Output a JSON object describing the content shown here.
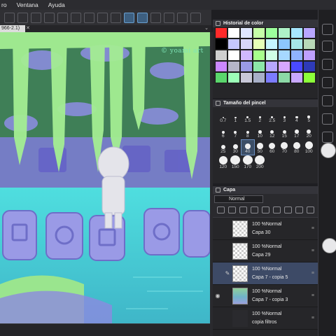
{
  "menu": {
    "items": [
      "ro",
      "Ventana",
      "Ayuda"
    ]
  },
  "document": {
    "tab_title": "966-2.1)",
    "close_glyph": "✕",
    "chevron_glyph": "⌄"
  },
  "canvas": {
    "watermark": "© yoami art",
    "colors": {
      "foliage": "#9be68f",
      "stone": "#8c8ae0",
      "water": "#52dfe0",
      "dark_green": "#2f6b45"
    }
  },
  "color_history": {
    "title": "Historial de color",
    "swatches": [
      "#ff2a2a",
      "#ffffff",
      "#dfe6ff",
      "#c6ffa8",
      "#9cff9c",
      "#aef2c8",
      "#a6e6ff",
      "#b8a6ff",
      "#000000",
      "#c5c8ff",
      "#d7d7f7",
      "#e6ffb8",
      "#c6f5ff",
      "#8cc6ff",
      "#a6e6e6",
      "#b8d8b8",
      "#cfcfcf",
      "#ffffff",
      "#d0b8ff",
      "#a8ff8c",
      "#d0ffe6",
      "#a6d8ff",
      "#8fb2ff",
      "#bfa0ff",
      "#cc88ff",
      "#b5b5c8",
      "#9a9ae6",
      "#8ce6a8",
      "#b8a6ff",
      "#d6a6ff",
      "#4a4aff",
      "#2e3ab8",
      "#5ad66c",
      "#9cffb8",
      "#c8c8d8",
      "#a8b0c8",
      "#7c7cff",
      "#8cd8a6",
      "#c8a8ff",
      "#8cff3a"
    ]
  },
  "brush_size": {
    "title": "Tamaño del pincel",
    "sizes": [
      "0.7",
      "1",
      "1.5",
      "2",
      "2.5",
      "3",
      "4",
      "5",
      "6",
      "7",
      "8",
      "10",
      "12",
      "15",
      "17",
      "20",
      "25",
      "30",
      "40",
      "50",
      "60",
      "70",
      "80",
      "100",
      "120",
      "150",
      "170",
      "200"
    ],
    "selected": "40"
  },
  "layers": {
    "title": "Capa",
    "blend_mode": "Normal",
    "items": [
      {
        "opacity": "100 %Normal",
        "name": "Capa 30",
        "type": "transparent",
        "selected": false,
        "visible": false,
        "editing": false
      },
      {
        "opacity": "100 %Normal",
        "name": "Capa 29",
        "type": "transparent",
        "selected": false,
        "visible": false,
        "editing": false
      },
      {
        "opacity": "100 %Normal",
        "name": "Capa 7 - copia 5",
        "type": "transparent",
        "selected": true,
        "visible": false,
        "editing": true
      },
      {
        "opacity": "100 %Normal",
        "name": "Capa 7 - copia 3",
        "type": "image",
        "selected": false,
        "visible": true,
        "editing": false
      },
      {
        "opacity": "100 %Normal",
        "name": "copia filtros",
        "type": "folder",
        "selected": false,
        "visible": false,
        "editing": false
      }
    ]
  }
}
